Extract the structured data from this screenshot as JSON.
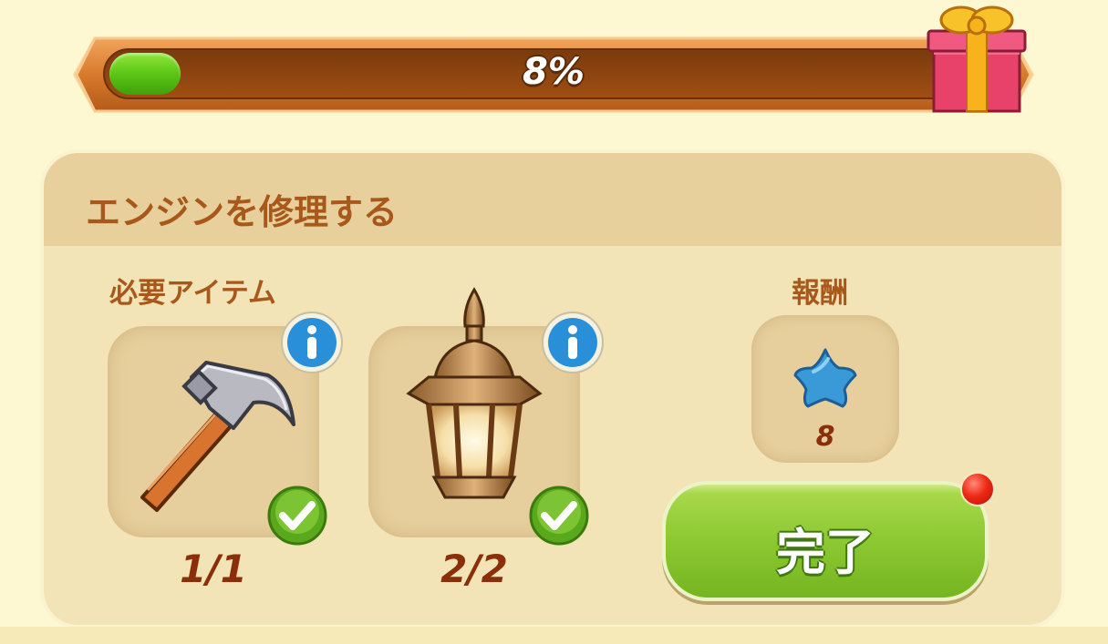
{
  "progress": {
    "percent_label": "8%",
    "fraction": 0.08
  },
  "quest": {
    "title": "エンジンを修理する",
    "required_label": "必要アイテム",
    "reward_label": "報酬",
    "items": [
      {
        "icon": "hammer-icon",
        "count": "1/1",
        "completed": true
      },
      {
        "icon": "lantern-icon",
        "count": "2/2",
        "completed": true
      }
    ],
    "reward": {
      "icon": "blue-star-icon",
      "count": "8"
    },
    "complete_button": "完了"
  },
  "colors": {
    "accent_green": "#8cc832",
    "text_brown": "#a8581a",
    "count_brown": "#8a2f0a",
    "info_blue": "#2a8fd9",
    "notify_red": "#ef2a14"
  }
}
